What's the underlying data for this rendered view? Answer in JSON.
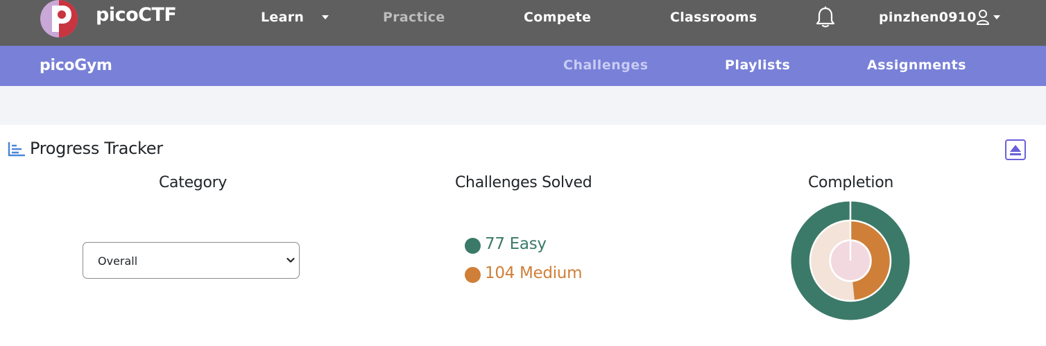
{
  "topnav": {
    "brand": "picoCTF",
    "items": [
      {
        "label": "Learn"
      },
      {
        "label": "Practice"
      },
      {
        "label": "Compete"
      },
      {
        "label": "Classrooms"
      }
    ],
    "username": "pinzhen0910"
  },
  "subnav": {
    "brand": "picoGym",
    "items": [
      {
        "label": "Challenges"
      },
      {
        "label": "Playlists"
      },
      {
        "label": "Assignments"
      }
    ]
  },
  "tracker": {
    "title": "Progress Tracker",
    "category_heading": "Category",
    "solved_heading": "Challenges Solved",
    "completion_heading": "Completion",
    "category_value": "Overall",
    "solved": [
      {
        "text": "77 Easy",
        "color": "#3b7a68"
      },
      {
        "text": "104 Medium",
        "color": "#cf7f37"
      }
    ]
  },
  "colors": {
    "topnav_bg": "#5f5f5f",
    "subnav_bg": "#7880d8",
    "easy": "#3b7a68",
    "medium": "#cf7f37",
    "medium_light": "#f3e3d8",
    "hard_light": "#f2d9df",
    "accent": "#6a60d8"
  },
  "icons": [
    "picoctf-logo",
    "chevron-down-icon",
    "bell-icon",
    "user-icon",
    "bar-chart-icon",
    "collapse-up-icon",
    "select-chevron-icon"
  ]
}
